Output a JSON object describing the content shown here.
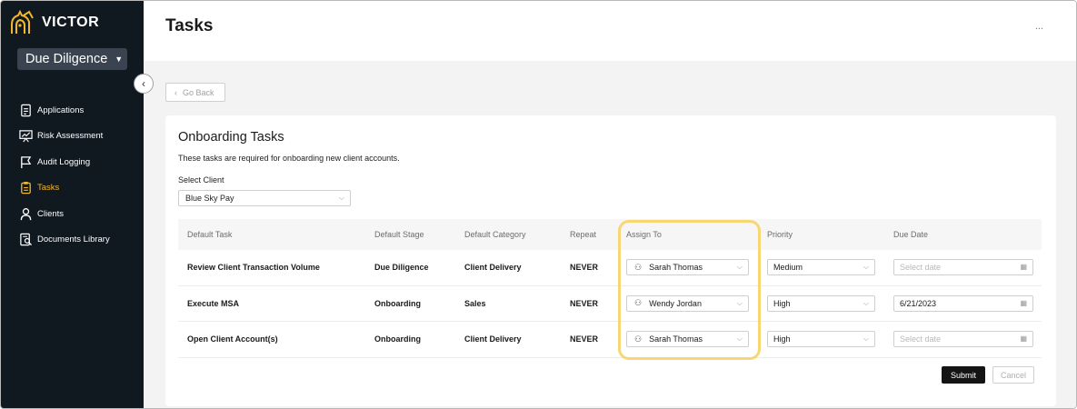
{
  "brand": {
    "name": "VICTOR",
    "accent": "#f2b82b",
    "sidebar_bg": "#101820"
  },
  "project": {
    "selected": "Due Diligence"
  },
  "sidebar": {
    "items": [
      {
        "label": "Applications",
        "icon": "document-icon",
        "active": false
      },
      {
        "label": "Risk Assessment",
        "icon": "presentation-chart-icon",
        "active": false
      },
      {
        "label": "Audit Logging",
        "icon": "flag-icon",
        "active": false
      },
      {
        "label": "Tasks",
        "icon": "clipboard-icon",
        "active": true
      },
      {
        "label": "Clients",
        "icon": "user-icon",
        "active": false
      },
      {
        "label": "Documents Library",
        "icon": "document-search-icon",
        "active": false
      }
    ]
  },
  "header": {
    "title": "Tasks",
    "more_label": "..."
  },
  "back": {
    "label": "Go Back"
  },
  "card": {
    "title": "Onboarding Tasks",
    "description": "These tasks are required for onboarding new client accounts.",
    "client_label": "Select Client",
    "client_value": "Blue Sky Pay"
  },
  "table": {
    "columns": [
      "Default Task",
      "Default Stage",
      "Default Category",
      "Repeat",
      "Assign To",
      "Priority",
      "Due Date"
    ],
    "rows": [
      {
        "task": "Review Client Transaction Volume",
        "stage": "Due Diligence",
        "category": "Client Delivery",
        "repeat": "NEVER",
        "assign": "Sarah Thomas",
        "priority": "Medium",
        "due": "",
        "due_placeholder": "Select date"
      },
      {
        "task": "Execute MSA",
        "stage": "Onboarding",
        "category": "Sales",
        "repeat": "NEVER",
        "assign": "Wendy Jordan",
        "priority": "High",
        "due": "6/21/2023",
        "due_placeholder": "Select date"
      },
      {
        "task": "Open Client Account(s)",
        "stage": "Onboarding",
        "category": "Client Delivery",
        "repeat": "NEVER",
        "assign": "Sarah Thomas",
        "priority": "High",
        "due": "",
        "due_placeholder": "Select date"
      }
    ]
  },
  "actions": {
    "submit_label": "Submit",
    "cancel_label": "Cancel"
  },
  "highlight_color": "#f7d774"
}
